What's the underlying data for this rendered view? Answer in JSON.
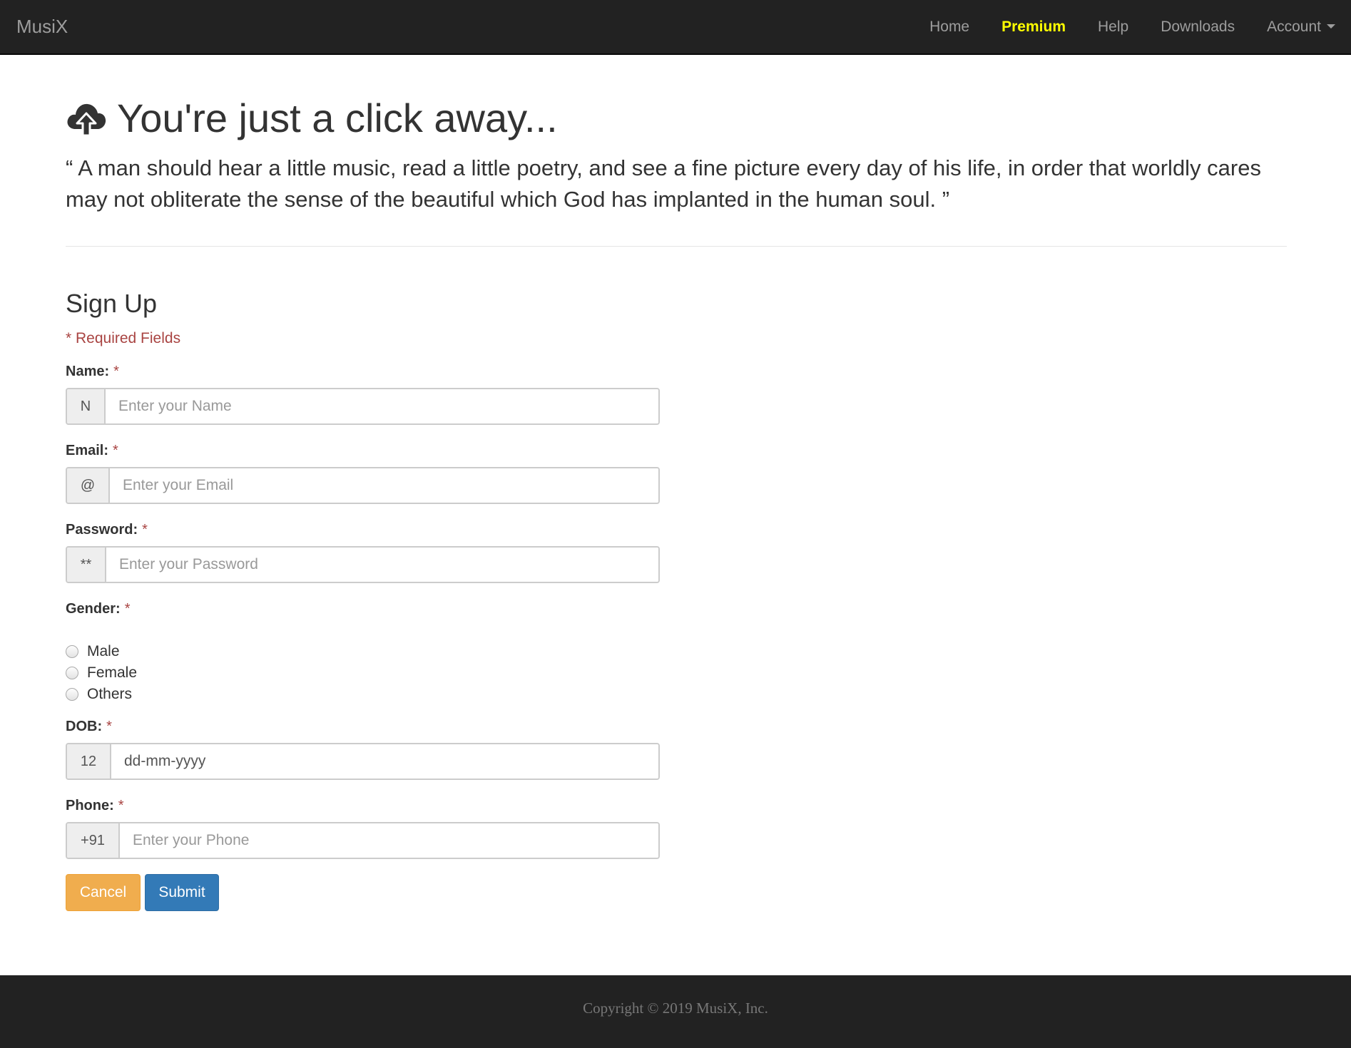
{
  "navbar": {
    "brand": "MusiX",
    "items": [
      {
        "label": "Home"
      },
      {
        "label": "Premium"
      },
      {
        "label": "Help"
      },
      {
        "label": "Downloads"
      },
      {
        "label": "Account"
      }
    ]
  },
  "hero": {
    "icon": "cloud-upload-icon",
    "title": "You're just a click away...",
    "quote": "“ A man should hear a little music, read a little poetry, and see a fine picture every day of his life, in order that worldly cares may not obliterate the sense of the beautiful which God has implanted in the human soul. ”"
  },
  "form": {
    "title": "Sign Up",
    "required_note": "* Required Fields",
    "required_mark": "*",
    "name": {
      "label": "Name:",
      "addon": "N",
      "placeholder": "Enter your Name",
      "value": ""
    },
    "email": {
      "label": "Email:",
      "addon": "@",
      "placeholder": "Enter your Email",
      "value": ""
    },
    "password": {
      "label": "Password:",
      "addon": "**",
      "placeholder": "Enter your Password",
      "value": ""
    },
    "gender": {
      "label": "Gender:",
      "options": [
        "Male",
        "Female",
        "Others"
      ]
    },
    "dob": {
      "label": "DOB:",
      "addon": "12",
      "placeholder": "dd-mm-yyyy",
      "value": ""
    },
    "phone": {
      "label": "Phone:",
      "addon": "+91",
      "placeholder": "Enter your Phone",
      "value": ""
    },
    "cancel_label": "Cancel",
    "submit_label": "Submit"
  },
  "footer": {
    "copyright": "Copyright © 2019 MusiX, Inc."
  },
  "colors": {
    "navbar_bg": "#222222",
    "premium_highlight": "#ffff00",
    "required_red": "#a94442",
    "cancel_button": "#f0ad4e",
    "submit_button": "#337ab7"
  }
}
